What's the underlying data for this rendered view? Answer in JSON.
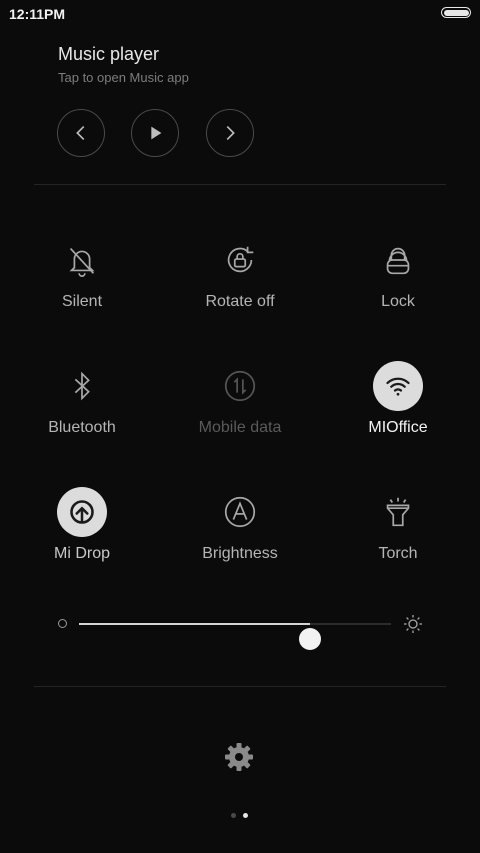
{
  "status": {
    "time": "12:11PM"
  },
  "music": {
    "title": "Music player",
    "subtitle": "Tap to open Music app",
    "controls": [
      {
        "icon": "previous-icon"
      },
      {
        "icon": "play-icon"
      },
      {
        "icon": "next-icon"
      }
    ]
  },
  "toggles": [
    {
      "label": "Silent",
      "icon": "bell-off-icon",
      "state": "off"
    },
    {
      "label": "Rotate off",
      "icon": "rotate-lock-icon",
      "state": "off"
    },
    {
      "label": "Lock",
      "icon": "lock-icon",
      "state": "off"
    },
    {
      "label": "Bluetooth",
      "icon": "bluetooth-icon",
      "state": "off"
    },
    {
      "label": "Mobile data",
      "icon": "mobile-data-icon",
      "state": "disabled"
    },
    {
      "label": "MIOffice",
      "icon": "wifi-icon",
      "state": "on"
    },
    {
      "label": "Mi Drop",
      "icon": "mi-drop-icon",
      "state": "on"
    },
    {
      "label": "Brightness",
      "icon": "auto-brightness-icon",
      "state": "off"
    },
    {
      "label": "Torch",
      "icon": "flashlight-icon",
      "state": "off"
    }
  ],
  "brightness": {
    "level": 0.74
  },
  "footer": {
    "page_count": 2,
    "active_page": 2
  },
  "colors": {
    "background": "#0b0b0b",
    "active_circle": "#dcdcdc",
    "label": "#b5b5b5",
    "disabled": "#5a5a5a"
  }
}
